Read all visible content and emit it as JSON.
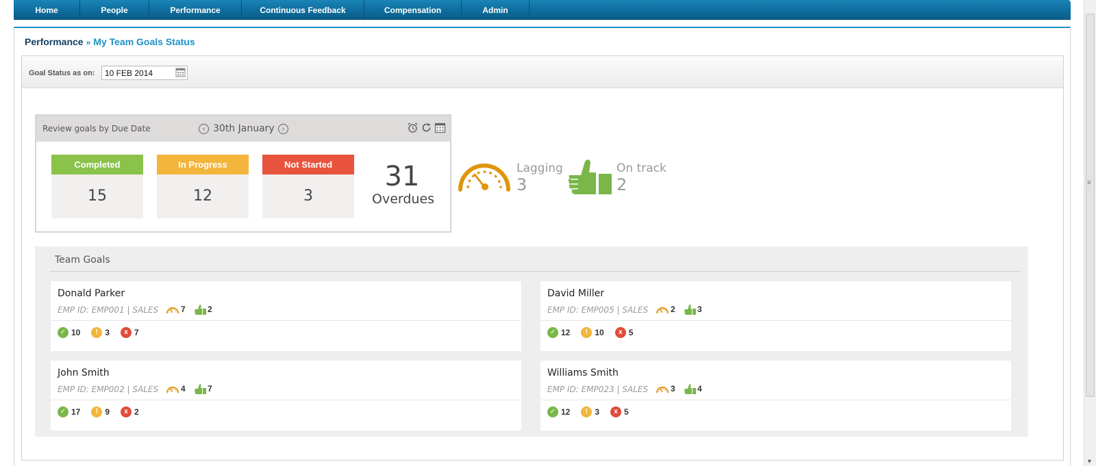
{
  "nav": {
    "items": [
      {
        "label": "Home"
      },
      {
        "label": "People"
      },
      {
        "label": "Performance"
      },
      {
        "label": "Continuous Feedback"
      },
      {
        "label": "Compensation"
      },
      {
        "label": "Admin"
      }
    ]
  },
  "breadcrumb": {
    "root": "Performance",
    "separator": "»",
    "current": "My Team Goals Status"
  },
  "filter": {
    "label": "Goal Status as on:",
    "date_value": "10 FEB 2014"
  },
  "review": {
    "title": "Review goals by Due Date",
    "date": "30th January",
    "completed": {
      "label": "Completed",
      "value": "15",
      "color": "#8bc24a"
    },
    "in_progress": {
      "label": "In Progress",
      "value": "12",
      "color": "#f3b53c"
    },
    "not_started": {
      "label": "Not Started",
      "value": "3",
      "color": "#e8533d"
    },
    "overdue": {
      "value": "31",
      "label": "Overdues"
    }
  },
  "summary": {
    "lagging": {
      "label": "Lagging",
      "value": "3",
      "color": "#e0950c"
    },
    "on_track": {
      "label": "On track",
      "value": "2",
      "color": "#7ab648"
    }
  },
  "team": {
    "title": "Team Goals",
    "employees": [
      {
        "name": "Donald Parker",
        "meta": "EMP ID: EMP001 | SALES",
        "lagging": "7",
        "on_track": "2",
        "completed": "10",
        "in_progress": "3",
        "not_started": "7"
      },
      {
        "name": "David Miller",
        "meta": "EMP ID: EMP005 | SALES",
        "lagging": "2",
        "on_track": "3",
        "completed": "12",
        "in_progress": "10",
        "not_started": "5"
      },
      {
        "name": "John Smith",
        "meta": "EMP ID: EMP002 | SALES",
        "lagging": "4",
        "on_track": "7",
        "completed": "17",
        "in_progress": "9",
        "not_started": "2"
      },
      {
        "name": "Williams Smith",
        "meta": "EMP ID: EMP023 | SALES",
        "lagging": "3",
        "on_track": "4",
        "completed": "12",
        "in_progress": "3",
        "not_started": "5"
      }
    ]
  },
  "icons": {
    "status_ok": "✓",
    "status_warn": "!",
    "status_fail": "x"
  }
}
